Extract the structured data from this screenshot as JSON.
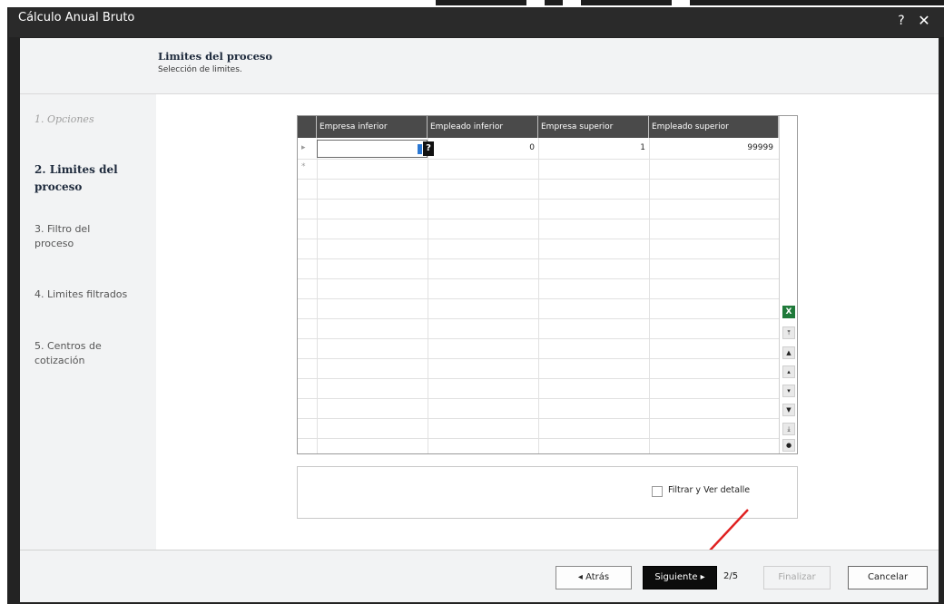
{
  "window": {
    "title": "Cálculo Anual Bruto",
    "help_label": "?",
    "close_label": "✕"
  },
  "header": {
    "title": "Limites del proceso",
    "subtitle": "Selección de limites."
  },
  "steps": [
    {
      "label": "1. Opciones",
      "state": "done"
    },
    {
      "label": "2. Limites del proceso",
      "state": "active"
    },
    {
      "label": "3. Filtro del proceso",
      "state": "pending"
    },
    {
      "label": "4. Limites filtrados",
      "state": "pending"
    },
    {
      "label": "5. Centros de cotización",
      "state": "pending"
    }
  ],
  "grid": {
    "columns": [
      "Empresa inferior",
      "Empleado inferior",
      "Empresa superior",
      "Empleado superior"
    ],
    "rows": [
      {
        "indicator": "▸",
        "values": [
          "0",
          "0",
          "1",
          "99999"
        ]
      },
      {
        "indicator": "*",
        "values": [
          "",
          "",
          "",
          ""
        ]
      }
    ],
    "help_button": "?",
    "excel_icon_label": "X"
  },
  "options": {
    "filter_checkbox_label": "Filtrar y Ver detalle",
    "filter_checked": false
  },
  "footer": {
    "back_label": "◂  Atrás",
    "next_label": "Siguiente ▸",
    "pager": "2/5",
    "finish_label": "Finalizar",
    "cancel_label": "Cancelar"
  },
  "colors": {
    "title_bar": "#2a2a2a",
    "panel": "#f2f3f4",
    "grid_header": "#4a4a4a",
    "primary_button": "#0c0c0c",
    "annotation_arrow": "#e02020"
  }
}
